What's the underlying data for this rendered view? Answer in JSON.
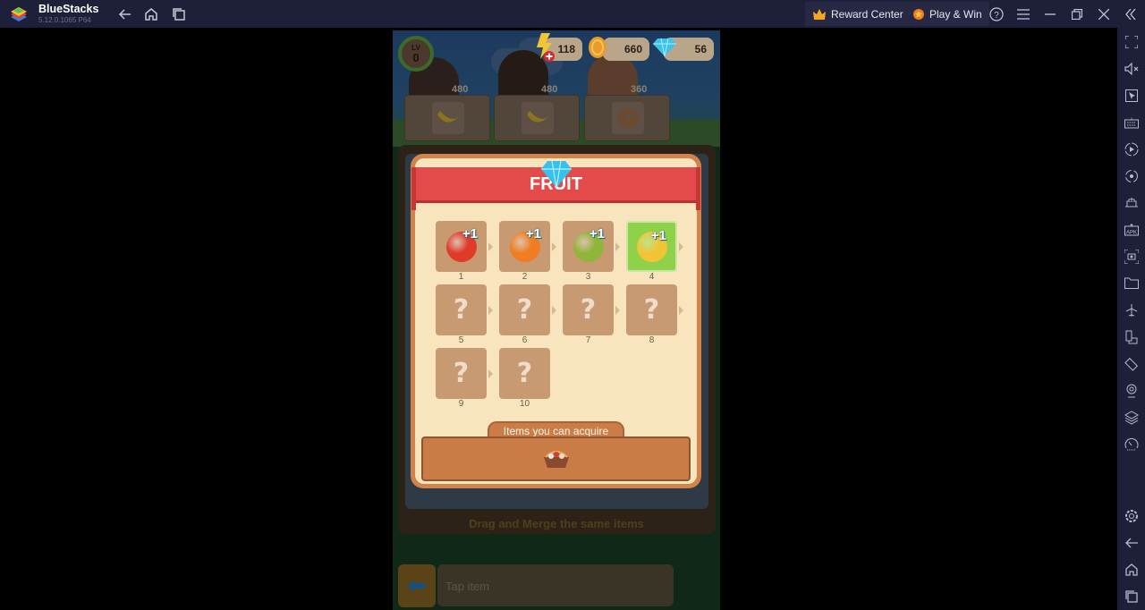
{
  "titlebar": {
    "app_name": "BlueStacks",
    "version": "5.12.0.1065 P64",
    "nav": [
      "back-icon",
      "home-icon",
      "recent-apps-icon"
    ],
    "reward_center_label": "Reward Center",
    "play_win_label": "Play & Win",
    "controls": [
      "help-icon",
      "menu-icon",
      "minimize-icon",
      "restore-icon",
      "close-icon",
      "collapse-sidebar-icon"
    ]
  },
  "sidebar": {
    "items": [
      {
        "name": "fullscreen",
        "icon": "fullscreen-icon"
      },
      {
        "name": "volume",
        "icon": "mute-icon"
      },
      {
        "name": "pointer",
        "icon": "cursor-icon"
      },
      {
        "name": "keyboard",
        "icon": "keyboard-icon"
      },
      {
        "name": "macro",
        "icon": "record-icon"
      },
      {
        "name": "sync",
        "icon": "sync-icon"
      },
      {
        "name": "performance",
        "icon": "performance-icon"
      },
      {
        "name": "install-apk",
        "icon": "apk-icon"
      },
      {
        "name": "screenshot",
        "icon": "screenshot-icon"
      },
      {
        "name": "files",
        "icon": "folder-icon"
      },
      {
        "name": "airplane",
        "icon": "airplane-icon"
      },
      {
        "name": "multi-instance",
        "icon": "multi-instance-icon"
      },
      {
        "name": "rotate",
        "icon": "rotate-icon"
      },
      {
        "name": "location",
        "icon": "location-icon"
      },
      {
        "name": "layers",
        "icon": "layers-icon"
      },
      {
        "name": "eco-mode",
        "icon": "speedometer-icon"
      }
    ],
    "bottom_items": [
      {
        "name": "settings",
        "icon": "gear-icon"
      },
      {
        "name": "back",
        "icon": "back-icon"
      },
      {
        "name": "home",
        "icon": "home-icon"
      },
      {
        "name": "recents",
        "icon": "recent-apps-icon"
      }
    ]
  },
  "game": {
    "level_label": "LV",
    "level": "0",
    "energy": "118",
    "coins": "660",
    "gems": "56",
    "orders": [
      {
        "price": "480",
        "item": "banana"
      },
      {
        "price": "480",
        "item": "banana"
      },
      {
        "price": "360",
        "item": "donut"
      }
    ],
    "hint": "Drag and Merge the same items",
    "tap_placeholder": "Tap item"
  },
  "modal": {
    "title": "FRUIT",
    "items": [
      {
        "level": "1",
        "name": "tomato",
        "bonus": "+1",
        "unlocked": true,
        "color": "#e03a2a"
      },
      {
        "level": "2",
        "name": "orange",
        "bonus": "+1",
        "unlocked": true,
        "color": "#f07d22"
      },
      {
        "level": "3",
        "name": "green apple",
        "bonus": "+1",
        "unlocked": true,
        "color": "#8fb53a"
      },
      {
        "level": "4",
        "name": "banana",
        "bonus": "+1",
        "unlocked": true,
        "active": true,
        "color": "#f1c435"
      },
      {
        "level": "5",
        "label": "?",
        "unlocked": false
      },
      {
        "level": "6",
        "label": "?",
        "unlocked": false
      },
      {
        "level": "7",
        "label": "?",
        "unlocked": false
      },
      {
        "level": "8",
        "label": "?",
        "unlocked": false
      },
      {
        "level": "9",
        "label": "?",
        "unlocked": false
      },
      {
        "level": "10",
        "label": "?",
        "unlocked": false
      }
    ],
    "acquire_label": "Items you can acquire",
    "acquire_item": "fruit-basket"
  }
}
